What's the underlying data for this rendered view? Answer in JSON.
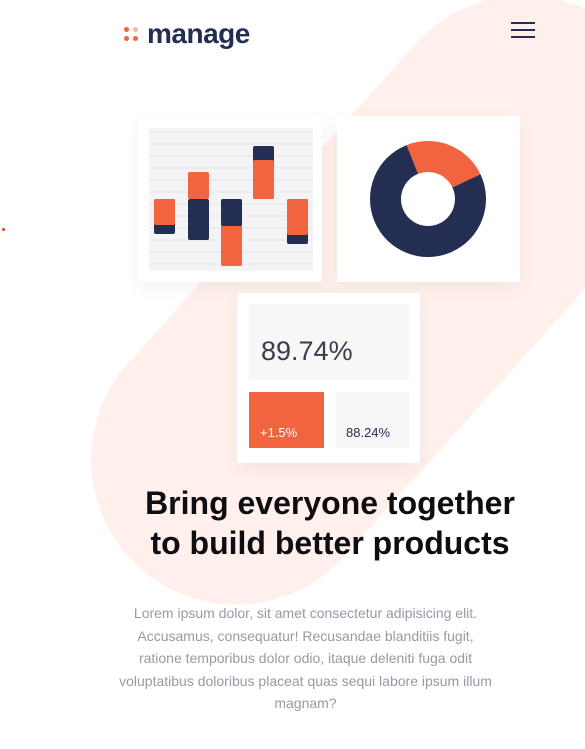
{
  "brand": {
    "name": "manage",
    "accent": "#f26440",
    "dark": "#242d52",
    "logo_dot_colors": [
      "#f26440",
      "#f9b5a2",
      "#f26440",
      "#f26440"
    ]
  },
  "nav": {
    "menu_icon": "hamburger-icon"
  },
  "illustration": {
    "bar_chart": {
      "bars": [
        {
          "orange": 26,
          "navy": 9
        },
        {
          "orange": 27,
          "navy": 41
        },
        {
          "orange": 40,
          "navy": 27
        },
        {
          "orange": 39,
          "navy": 14
        },
        {
          "orange": 36,
          "navy": 9
        }
      ]
    },
    "donut": {
      "segments": [
        {
          "name": "accent",
          "fraction": 0.24,
          "color": "#f26440"
        },
        {
          "name": "dark",
          "fraction": 0.76,
          "color": "#242d52"
        }
      ]
    },
    "stats": {
      "main_value": "89.74%",
      "change_value": "+1.5%",
      "secondary_value": "88.24%"
    }
  },
  "hero": {
    "title_line1": "Bring everyone together",
    "title_line2": "to build better products",
    "description": "Lorem ipsum dolor, sit amet consectetur adipisicing elit. Accusamus, consequatur! Recusandae blanditiis fugit, ratione temporibus dolor odio, itaque deleniti fuga odit voluptatibus doloribus placeat quas sequi labore ipsum illum magnam?"
  }
}
